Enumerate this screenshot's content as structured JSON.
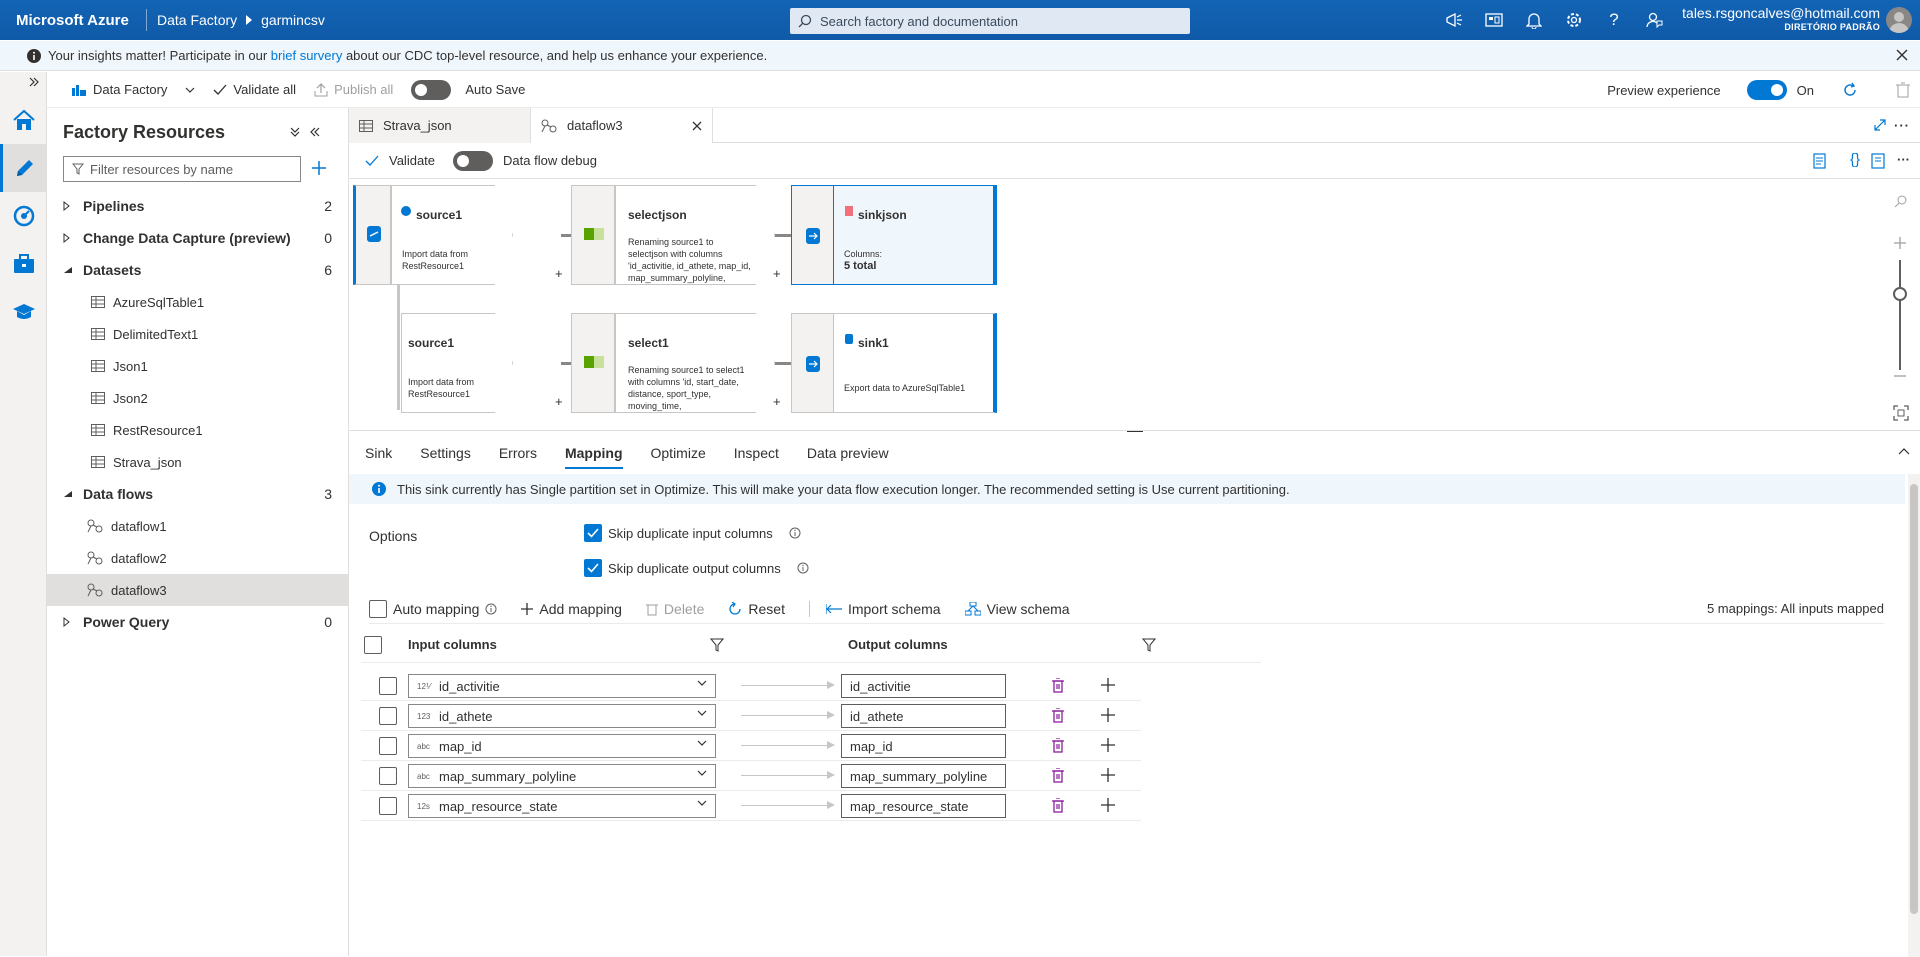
{
  "topbar": {
    "brand": "Microsoft Azure",
    "service": "Data Factory",
    "factory": "garmincsv",
    "search_placeholder": "Search factory and documentation",
    "user_email": "tales.rsgoncalves@hotmail.com",
    "user_dir": "DIRETÓRIO PADRÃO"
  },
  "banner": {
    "pre": "Your insights matter! Participate in our ",
    "link": "brief survery",
    "post": " about our CDC top-level resource, and help us enhance your experience."
  },
  "toolbar": {
    "factory_label": "Data Factory",
    "validate_all": "Validate all",
    "publish_all": "Publish all",
    "auto_save": "Auto Save",
    "preview_experience": "Preview experience",
    "preview_state": "On"
  },
  "resources": {
    "title": "Factory Resources",
    "filter_placeholder": "Filter resources by name",
    "groups": [
      {
        "label": "Pipelines",
        "count": "2",
        "items": []
      },
      {
        "label": "Change Data Capture (preview)",
        "count": "0",
        "items": []
      },
      {
        "label": "Datasets",
        "count": "6",
        "items": [
          "AzureSqlTable1",
          "DelimitedText1",
          "Json1",
          "Json2",
          "RestResource1",
          "Strava_json"
        ]
      },
      {
        "label": "Data flows",
        "count": "3",
        "items": [
          "dataflow1",
          "dataflow2",
          "dataflow3"
        ]
      },
      {
        "label": "Power Query",
        "count": "0",
        "items": []
      }
    ]
  },
  "tabs": [
    {
      "label": "Strava_json"
    },
    {
      "label": "dataflow3"
    }
  ],
  "dfbar": {
    "validate": "Validate",
    "debug": "Data flow debug"
  },
  "flow": {
    "row1": {
      "source_title": "source1",
      "source_desc1": "Import data from",
      "source_desc2": "RestResource1",
      "select_title": "selectjson",
      "select_desc1": "Renaming source1 to",
      "select_desc2": "selectjson with columns",
      "select_desc3": "'id_activitie, id_athete, map_id,",
      "select_desc4": "map_summary_polyline,",
      "sink_title": "sinkjson",
      "sink_cols_label": "Columns:",
      "sink_cols_value": "5 total"
    },
    "row2": {
      "source_title": "source1",
      "source_desc1": "Import data from",
      "source_desc2": "RestResource1",
      "select_title": "select1",
      "select_desc1": "Renaming source1 to select1",
      "select_desc2": "with columns 'id, start_date,",
      "select_desc3": "distance, sport_type,",
      "select_desc4": "moving_time,",
      "sink_title": "sink1",
      "sink_desc": "Export data to AzureSqlTable1"
    }
  },
  "panel": {
    "tabs": [
      "Sink",
      "Settings",
      "Errors",
      "Mapping",
      "Optimize",
      "Inspect",
      "Data preview"
    ],
    "active_tab": "Mapping",
    "info": "This sink currently has Single partition set in Optimize. This will make your data flow execution longer. The recommended setting is Use current partitioning.",
    "options_label": "Options",
    "skip_input": "Skip duplicate input columns",
    "skip_output": "Skip duplicate output columns",
    "auto_mapping": "Auto mapping",
    "add_mapping": "Add mapping",
    "delete": "Delete",
    "reset": "Reset",
    "import_schema": "Import schema",
    "view_schema": "View schema",
    "mappings_status": "5 mappings: All inputs mapped",
    "input_header": "Input columns",
    "output_header": "Output columns",
    "rows": [
      {
        "type": "12⅟",
        "input": "id_activitie",
        "output": "id_activitie"
      },
      {
        "type": "123",
        "input": "id_athete",
        "output": "id_athete"
      },
      {
        "type": "abc",
        "input": "map_id",
        "output": "map_id"
      },
      {
        "type": "abc",
        "input": "map_summary_polyline",
        "output": "map_summary_polyline"
      },
      {
        "type": "12s",
        "input": "map_resource_state",
        "output": "map_resource_state"
      }
    ]
  }
}
